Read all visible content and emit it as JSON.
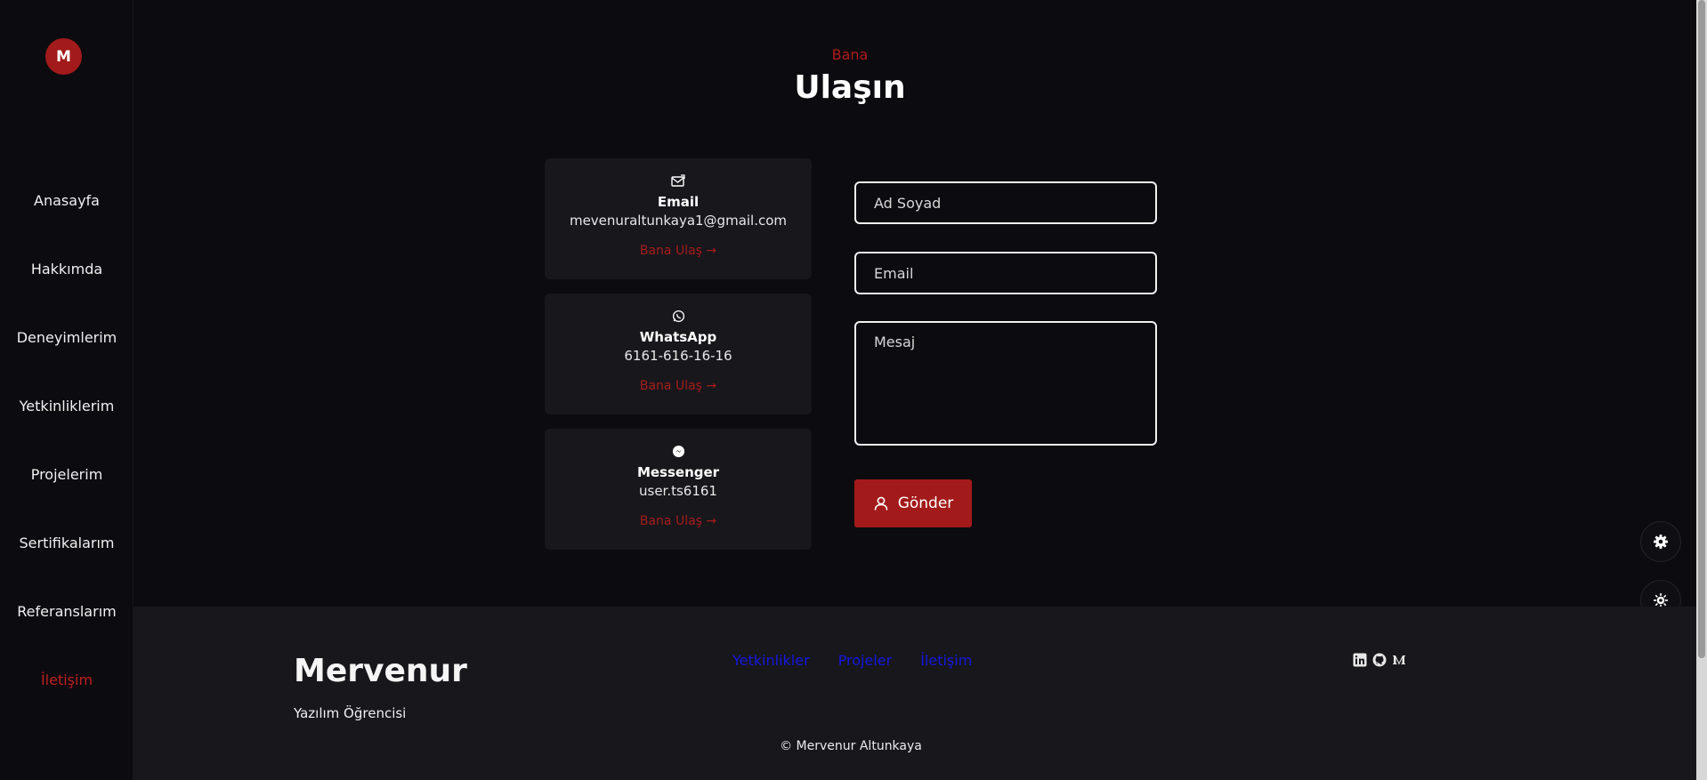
{
  "sidebar": {
    "logo_letter": "M",
    "items": [
      {
        "label": "Anasayfa"
      },
      {
        "label": "Hakkımda"
      },
      {
        "label": "Deneyimlerim"
      },
      {
        "label": "Yetkinliklerim"
      },
      {
        "label": "Projelerim"
      },
      {
        "label": "Sertifikalarım"
      },
      {
        "label": "Referanslarım"
      },
      {
        "label": "İletişim",
        "active": true
      }
    ]
  },
  "header": {
    "kicker": "Bana",
    "title": "Ulaşın"
  },
  "cards": [
    {
      "icon": "envelope-icon",
      "title": "Email",
      "value": "mevenuraltunkaya1@gmail.com",
      "link": "Bana Ulaş →"
    },
    {
      "icon": "whatsapp-icon",
      "title": "WhatsApp",
      "value": "6161-616-16-16",
      "link": "Bana Ulaş →"
    },
    {
      "icon": "messenger-icon",
      "title": "Messenger",
      "value": "user.ts6161",
      "link": "Bana Ulaş →"
    }
  ],
  "form": {
    "name_placeholder": "Ad Soyad",
    "email_placeholder": "Email",
    "message_placeholder": "Mesaj",
    "submit_label": "Gönder"
  },
  "footer": {
    "brand": "Mervenur",
    "tagline": "Yazılım Öğrencisi",
    "links": [
      "Yetkinlikler",
      "Projeler",
      "İletişim"
    ],
    "socials": [
      "linkedin-icon",
      "github-icon",
      "medium-icon"
    ],
    "copyright": "© Mervenur Altunkaya"
  },
  "colors": {
    "accent": "#a31a1a",
    "background": "#0b0b10",
    "card": "#17171c",
    "footer_link": "#1616e0"
  }
}
